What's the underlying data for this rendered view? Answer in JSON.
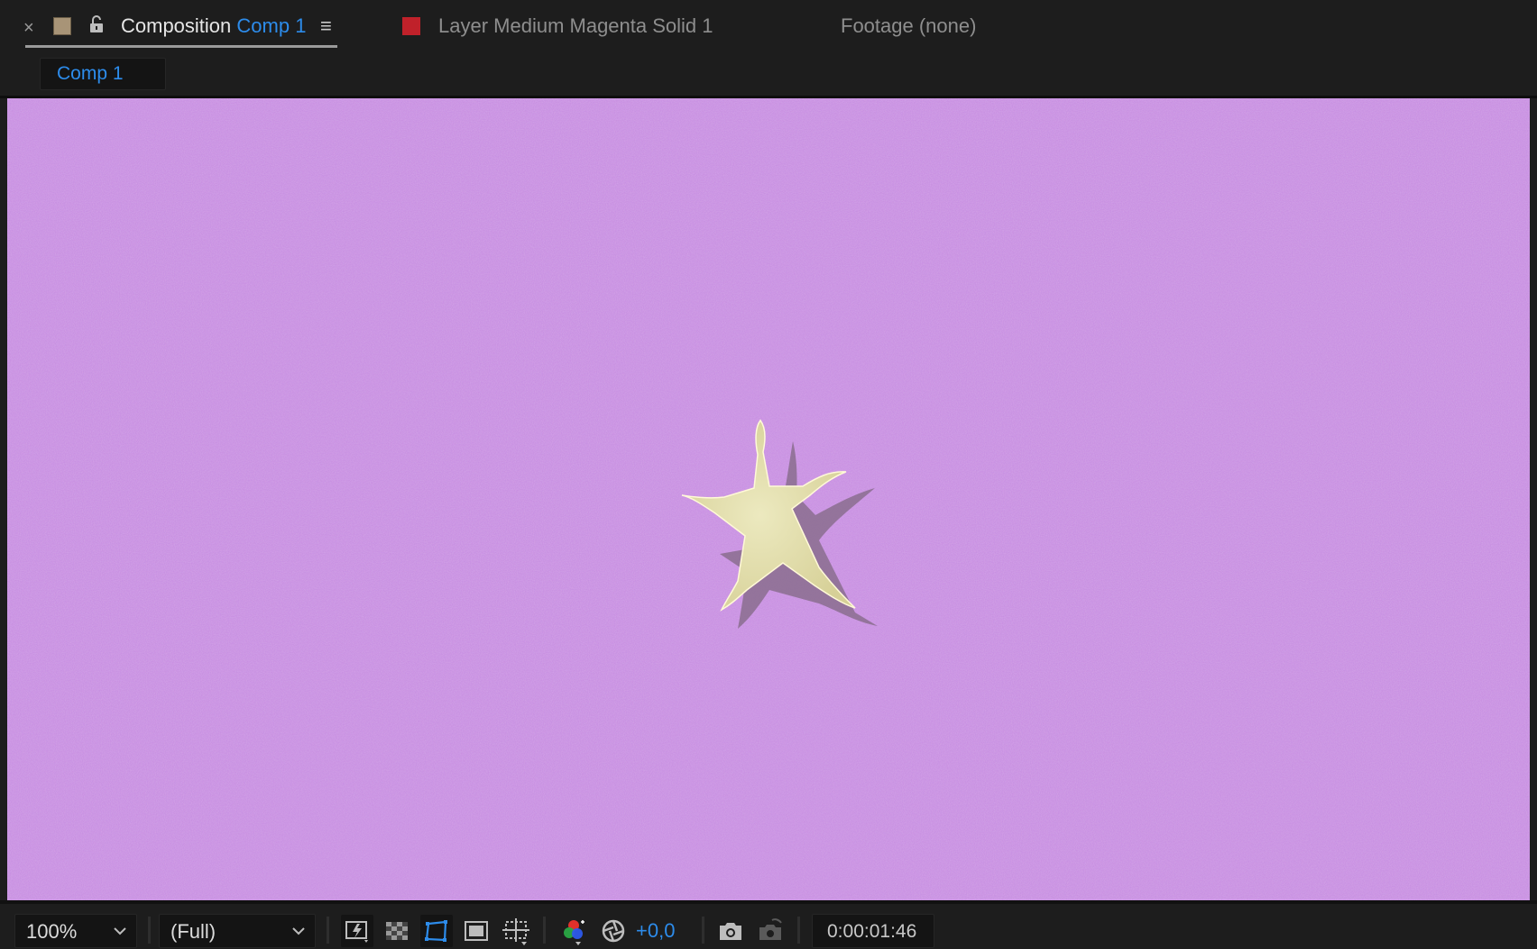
{
  "panel_tabs": {
    "close_glyph": "×",
    "composition_label": "Composition",
    "composition_name": "Comp 1",
    "menu_glyph": "≡",
    "layer_tab": "Layer Medium Magenta Solid 1",
    "footage_tab": "Footage (none)",
    "swatch_color": "#a89477",
    "layer_swatch_color": "#c0212a"
  },
  "viewer_subtab": {
    "label": "Comp 1"
  },
  "viewer": {
    "background_color": "#c68ce0",
    "star_color": "#e4e0ac",
    "shadow_color": "#8a6d8e"
  },
  "bottom_bar": {
    "magnification": "100%",
    "resolution": "(Full)",
    "exposure": "+0,0",
    "timecode": "0:00:01:46",
    "icons": [
      "fast-previews-icon",
      "transparency-grid-icon",
      "mask-path-visibility-icon",
      "region-of-interest-icon",
      "grid-guides-icon",
      "channel-icon",
      "reset-exposure-icon",
      "snapshot-icon",
      "show-snapshot-icon"
    ]
  }
}
